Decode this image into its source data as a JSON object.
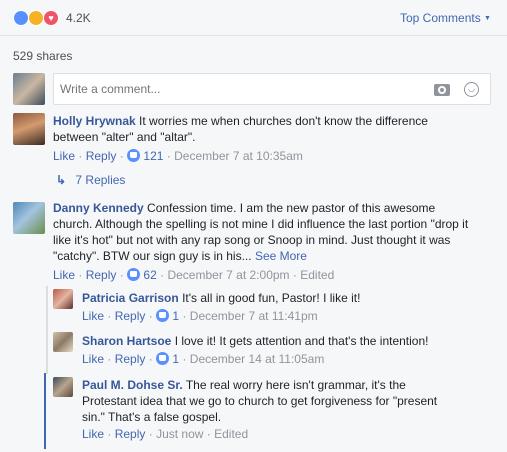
{
  "reactions": {
    "count": "4.2K",
    "colors": {
      "like": "#5890ff",
      "haha": "#f7b125",
      "love": "#f25268"
    }
  },
  "sort": {
    "label": "Top Comments"
  },
  "shares": {
    "label": "529 shares"
  },
  "composer": {
    "placeholder": "Write a comment..."
  },
  "comments": [
    {
      "author": "Holly Hrywnak",
      "text_lines": [
        "It worries me when churches don't know the difference",
        "between \"alter\" and \"altar\"."
      ],
      "like": "Like",
      "reply": "Reply",
      "reactions": "121",
      "time": "December 7 at 10:35am",
      "replies_label": "7 Replies"
    },
    {
      "author": "Danny Kennedy",
      "text_lines": [
        "Confession time. I am the new pastor of this awesome",
        "church. Although the spelling is not mine I did influence the last portion \"drop it",
        "like it's hot\" but not with any rap song or Snoop in mind. Just thought it was",
        "\"catchy\". BTW our sign guy is in his..."
      ],
      "see_more": "See More",
      "like": "Like",
      "reply": "Reply",
      "reactions": "62",
      "time": "December 7 at 2:00pm",
      "edited": "Edited"
    }
  ],
  "replies": [
    {
      "author": "Patricia Garrison",
      "text": "It's all in good fun, Pastor! I like it!",
      "like": "Like",
      "reply": "Reply",
      "reactions": "1",
      "time": "December 7 at 11:41pm"
    },
    {
      "author": "Sharon Hartsoe",
      "text": "I love it! It gets attention and that's the intention!",
      "like": "Like",
      "reply": "Reply",
      "reactions": "1",
      "time": "December 14 at 11:05am"
    },
    {
      "author": "Paul M. Dohse Sr.",
      "text_lines": [
        "The real worry here isn't grammar, it's the",
        "Protestant idea that we go to church to get forgiveness for \"present",
        "sin.\" That's a false gospel."
      ],
      "like": "Like",
      "reply": "Reply",
      "time": "Just now",
      "edited": "Edited"
    }
  ]
}
